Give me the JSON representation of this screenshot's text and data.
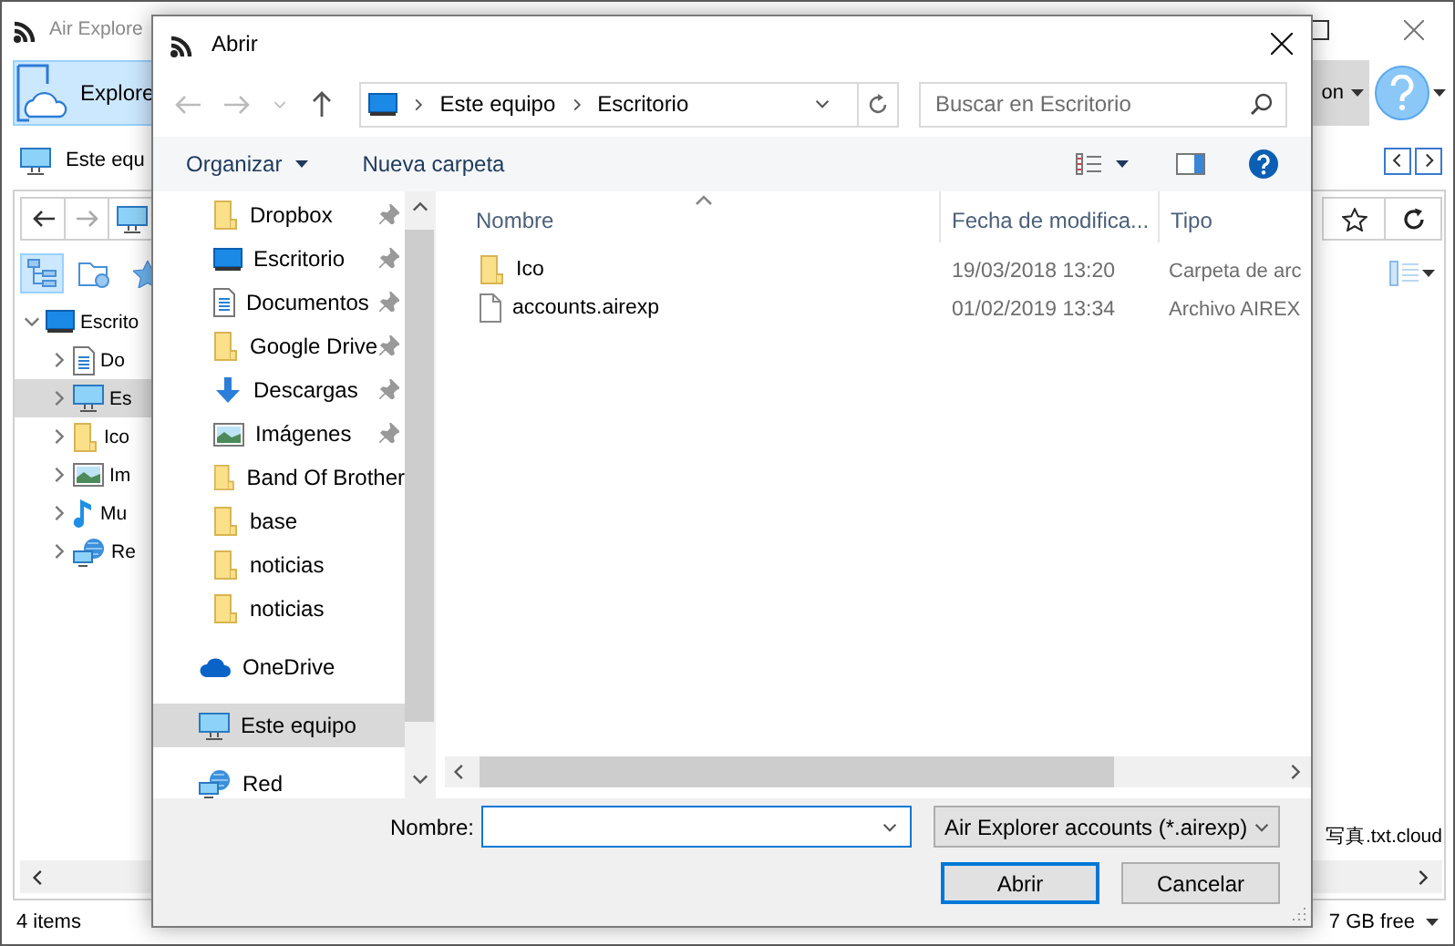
{
  "app": {
    "title": "Air Explore",
    "explore_button": "Explore",
    "account_button": "on",
    "location": "Este equ",
    "tree": [
      {
        "label": "Escrito",
        "kind": "desktop",
        "expanded": true,
        "selected": false,
        "children": [
          {
            "label": "Do",
            "kind": "document",
            "selected": false
          },
          {
            "label": "Es",
            "kind": "computer",
            "selected": true
          },
          {
            "label": "Ico",
            "kind": "folder",
            "selected": false
          },
          {
            "label": "Im",
            "kind": "image",
            "selected": false
          },
          {
            "label": "Mu",
            "kind": "music",
            "selected": false
          },
          {
            "label": "Re",
            "kind": "network",
            "selected": false
          }
        ]
      }
    ],
    "file_name": "写真.txt.cloud",
    "status": "4 items",
    "free_space": "7 GB free"
  },
  "dialog": {
    "title": "Abrir",
    "path": [
      "Este equipo",
      "Escritorio"
    ],
    "search": {
      "placeholder": "Buscar en Escritorio"
    },
    "toolbar": {
      "organize": "Organizar",
      "new_folder": "Nueva carpeta"
    },
    "nav_sections": [
      {
        "items": [
          {
            "label": "Dropbox",
            "kind": "folder",
            "pinned": true,
            "selected": false
          },
          {
            "label": "Escritorio",
            "kind": "desktop",
            "pinned": true,
            "selected": false
          },
          {
            "label": "Documentos",
            "kind": "document",
            "pinned": true,
            "selected": false
          },
          {
            "label": "Google Drive",
            "kind": "folder",
            "pinned": true,
            "selected": false
          },
          {
            "label": "Descargas",
            "kind": "download",
            "pinned": true,
            "selected": false
          },
          {
            "label": "Imágenes",
            "kind": "image",
            "pinned": true,
            "selected": false
          },
          {
            "label": "Band Of Brother",
            "kind": "folder",
            "pinned": false,
            "selected": false
          },
          {
            "label": "base",
            "kind": "folder",
            "pinned": false,
            "selected": false
          },
          {
            "label": "noticias",
            "kind": "folder",
            "pinned": false,
            "selected": false
          },
          {
            "label": "noticias",
            "kind": "folder",
            "pinned": false,
            "selected": false
          }
        ]
      },
      {
        "items": [
          {
            "label": "OneDrive",
            "kind": "cloud",
            "pinned": false,
            "selected": false
          },
          {
            "label": "Este equipo",
            "kind": "computer",
            "pinned": false,
            "selected": true
          },
          {
            "label": "Red",
            "kind": "network",
            "pinned": false,
            "selected": false
          }
        ]
      }
    ],
    "columns": [
      "Nombre",
      "Fecha de modifica...",
      "Tipo"
    ],
    "files": [
      {
        "name": "Ico",
        "kind": "folder",
        "modified": "19/03/2018 13:20",
        "type": "Carpeta de arc",
        "selected": false
      },
      {
        "name": "accounts.airexp",
        "kind": "file",
        "modified": "01/02/2019 13:34",
        "type": "Archivo AIREX",
        "selected": false
      }
    ],
    "file_name_label": "Nombre:",
    "filter": "Air Explorer accounts (*.airexp)",
    "buttons": {
      "open": "Abrir",
      "cancel": "Cancelar"
    }
  }
}
